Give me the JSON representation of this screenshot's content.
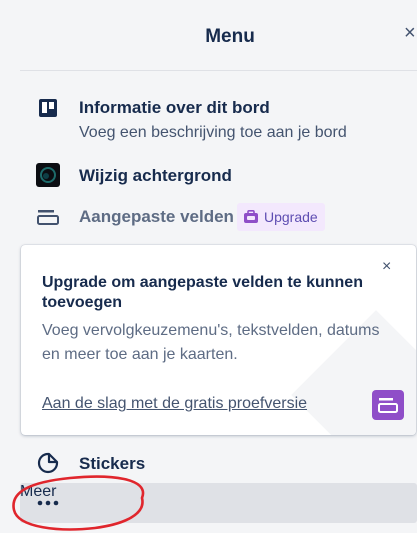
{
  "header": {
    "title": "Menu",
    "close_glyph": "×"
  },
  "menu_items": [
    {
      "label": "Informatie over dit bord",
      "description": "Voeg een beschrijving toe aan je bord",
      "icon": "board-info-icon"
    },
    {
      "label": "Wijzig achtergrond",
      "icon": "background-thumbnail-icon"
    },
    {
      "label": "Aangepaste velden",
      "icon": "custom-fields-icon",
      "badge": "Upgrade",
      "badge_icon": "upgrade-icon"
    }
  ],
  "promo_card": {
    "title": "Upgrade om aangepaste velden te kunnen toevoegen",
    "body": "Voeg vervolgkeuzemenu's, tekstvelden, datums en meer toe aan je kaarten.",
    "link": "Aan de slag met de gratis proefversie",
    "close_glyph": "×",
    "cta_icon": "custom-fields-icon"
  },
  "bottom_items": [
    {
      "label": "Stickers",
      "icon": "sticker-icon"
    },
    {
      "label": "Meer",
      "icon": "more-dots-icon"
    }
  ],
  "colors": {
    "accent_purple": "#8f4ec8",
    "badge_bg": "#f3e8fd",
    "annotation_red": "#e0262d"
  }
}
